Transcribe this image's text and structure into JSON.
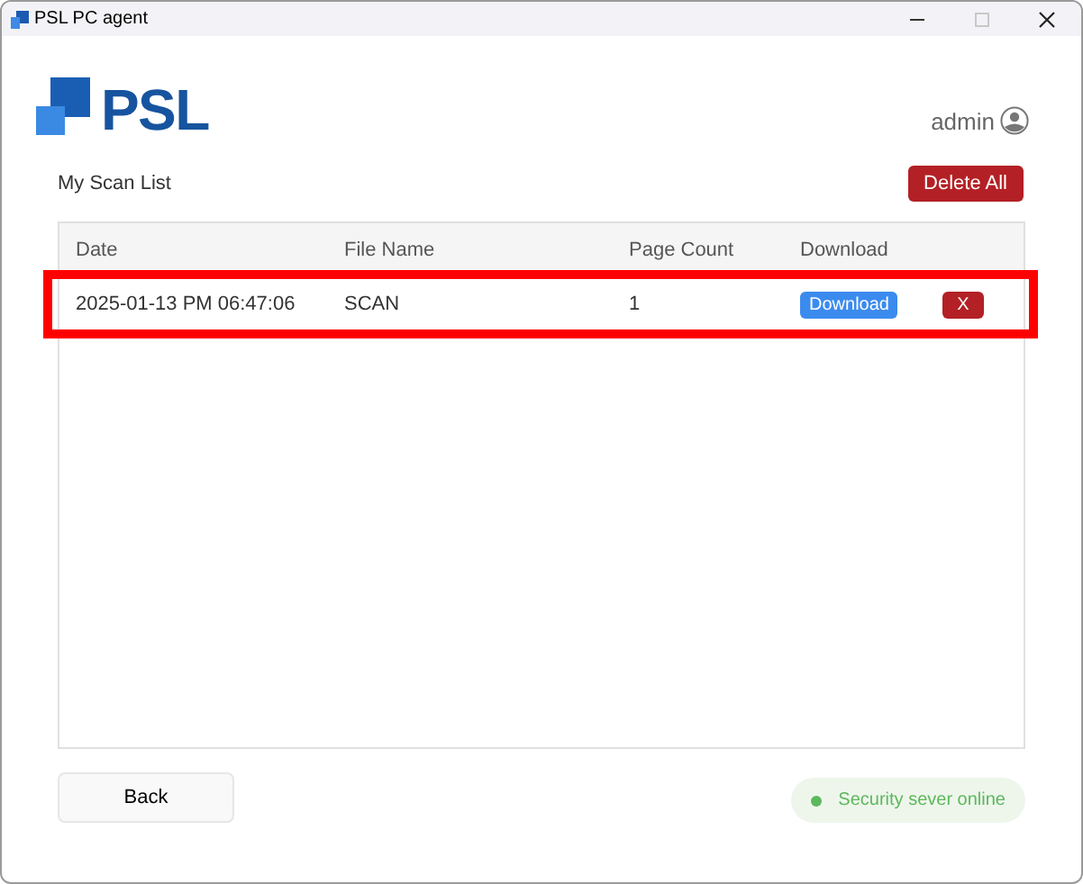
{
  "window": {
    "title": "PSL PC agent"
  },
  "logo": {
    "text": "PSL"
  },
  "user": {
    "name": "admin"
  },
  "list_title": "My Scan List",
  "delete_all_button": "Delete All",
  "table": {
    "columns": [
      "Date",
      "File Name",
      "Page Count",
      "Download"
    ],
    "rows": [
      {
        "date": "2025-01-13 PM 06:47:06",
        "file_name": "SCAN",
        "page_count": "1",
        "download_button": "Download",
        "delete_button": "X",
        "highlighted": true
      }
    ]
  },
  "back_button": "Back",
  "status": {
    "text": "Security sever online",
    "online": true
  }
}
